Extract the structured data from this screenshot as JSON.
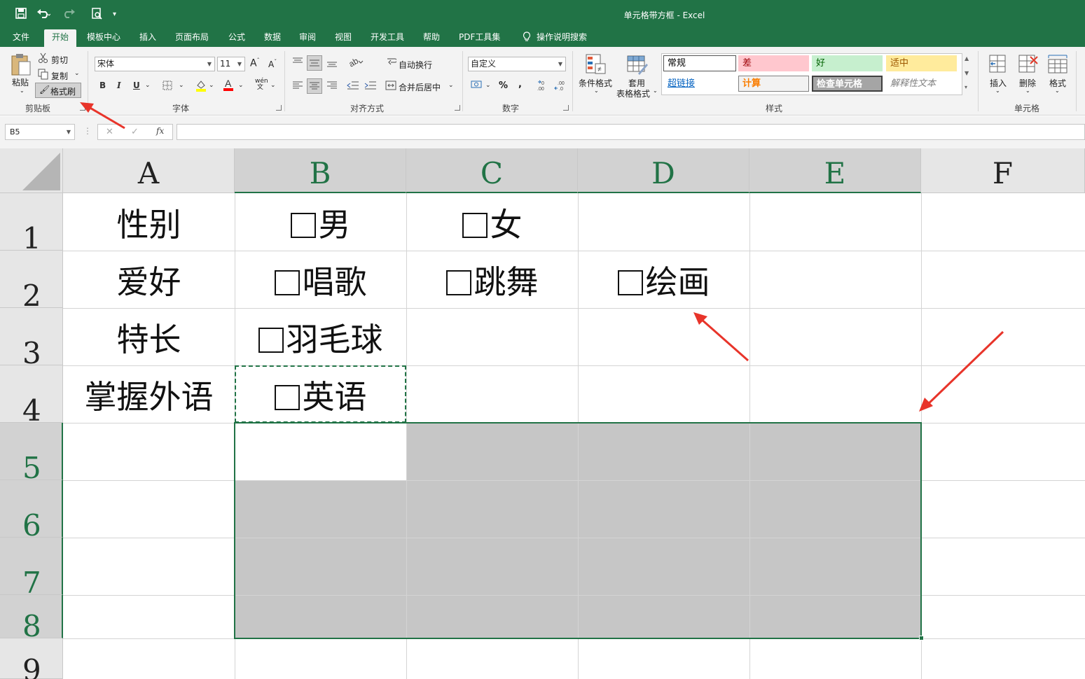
{
  "window": {
    "title": "单元格带方框 - Excel"
  },
  "menu_tabs": [
    "文件",
    "开始",
    "模板中心",
    "插入",
    "页面布局",
    "公式",
    "数据",
    "审阅",
    "视图",
    "开发工具",
    "帮助",
    "PDF工具集",
    "操作说明搜索"
  ],
  "active_tab": "开始",
  "ribbon": {
    "clipboard": {
      "paste": "粘贴",
      "cut": "剪切",
      "copy": "复制",
      "format_painter": "格式刷",
      "label": "剪贴板"
    },
    "font": {
      "name": "宋体",
      "size": "11",
      "bold": "B",
      "italic": "I",
      "underline": "U",
      "label": "字体"
    },
    "alignment": {
      "wrap": "自动换行",
      "merge": "合并后居中",
      "label": "对齐方式"
    },
    "number": {
      "format": "自定义",
      "percent": "%",
      "comma": ",",
      "label": "数字"
    },
    "styles": {
      "conditional": "条件格式",
      "table_line1": "套用",
      "table_line2": "表格格式",
      "cells": [
        {
          "name": "常规",
          "bg": "#ffffff",
          "fg": "#000000"
        },
        {
          "name": "差",
          "bg": "#ffc7ce",
          "fg": "#9c0006"
        },
        {
          "name": "好",
          "bg": "#c6efce",
          "fg": "#006100"
        },
        {
          "name": "适中",
          "bg": "#ffeb9c",
          "fg": "#9c5700"
        },
        {
          "name": "超链接",
          "bg": "#ffffff",
          "fg": "#0563c1"
        },
        {
          "name": "计算",
          "bg": "#f2f2f2",
          "fg": "#fa7d00"
        },
        {
          "name": "检查单元格",
          "bg": "#a5a5a5",
          "fg": "#ffffff"
        },
        {
          "name": "解释性文本",
          "bg": "#ffffff",
          "fg": "#7f7f7f"
        }
      ],
      "label": "样式"
    },
    "cells_group": {
      "insert": "插入",
      "delete": "删除",
      "format": "格式",
      "label": "单元格"
    }
  },
  "formula_bar": {
    "name_box": "B5",
    "fx": "fx",
    "cancel": "✕",
    "enter": "✓",
    "formula": ""
  },
  "sheet": {
    "columns": [
      "A",
      "B",
      "C",
      "D",
      "E",
      "F"
    ],
    "rows": [
      "1",
      "2",
      "3",
      "4",
      "5",
      "6",
      "7",
      "8",
      "9"
    ],
    "cells": {
      "A1": "性别",
      "B1": "男",
      "C1": "女",
      "A2": "爱好",
      "B2": "唱歌",
      "C2": "跳舞",
      "D2": "绘画",
      "A3": "特长",
      "B3": "羽毛球",
      "A4": "掌握外语",
      "B4": "英语"
    },
    "checkbox_glyph": "☐",
    "selection": "B5:E8",
    "copy_marquee": "B4",
    "accent": "#217346",
    "selection_fill": "#c6c6c6"
  },
  "annotations": {
    "arrow_color": "#e8342a"
  }
}
